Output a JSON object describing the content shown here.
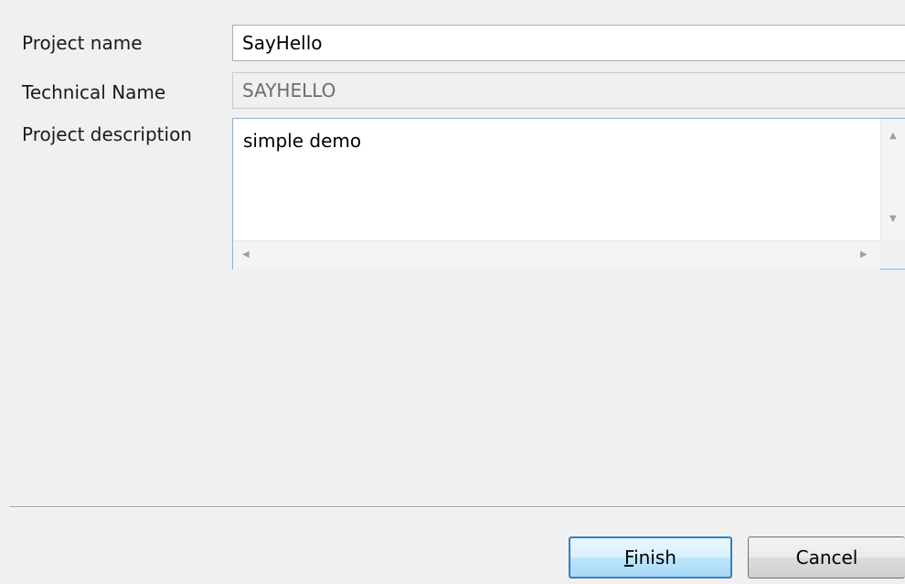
{
  "form": {
    "project_name_label": "Project name",
    "project_name_value": "SayHello",
    "technical_name_label": "Technical Name",
    "technical_name_value": "SAYHELLO",
    "description_label": "Project description",
    "description_value": "simple demo"
  },
  "buttons": {
    "finish_mnemonic": "F",
    "finish_rest": "inish",
    "cancel_label": "Cancel"
  },
  "colors": {
    "background": "#f0f0f0",
    "focus_border": "#7eb4ea",
    "default_button_border": "#3c7fb1"
  },
  "icons": {
    "scroll_up": "scroll-up-arrow-icon",
    "scroll_down": "scroll-down-arrow-icon",
    "scroll_left": "scroll-left-arrow-icon",
    "scroll_right": "scroll-right-arrow-icon"
  }
}
